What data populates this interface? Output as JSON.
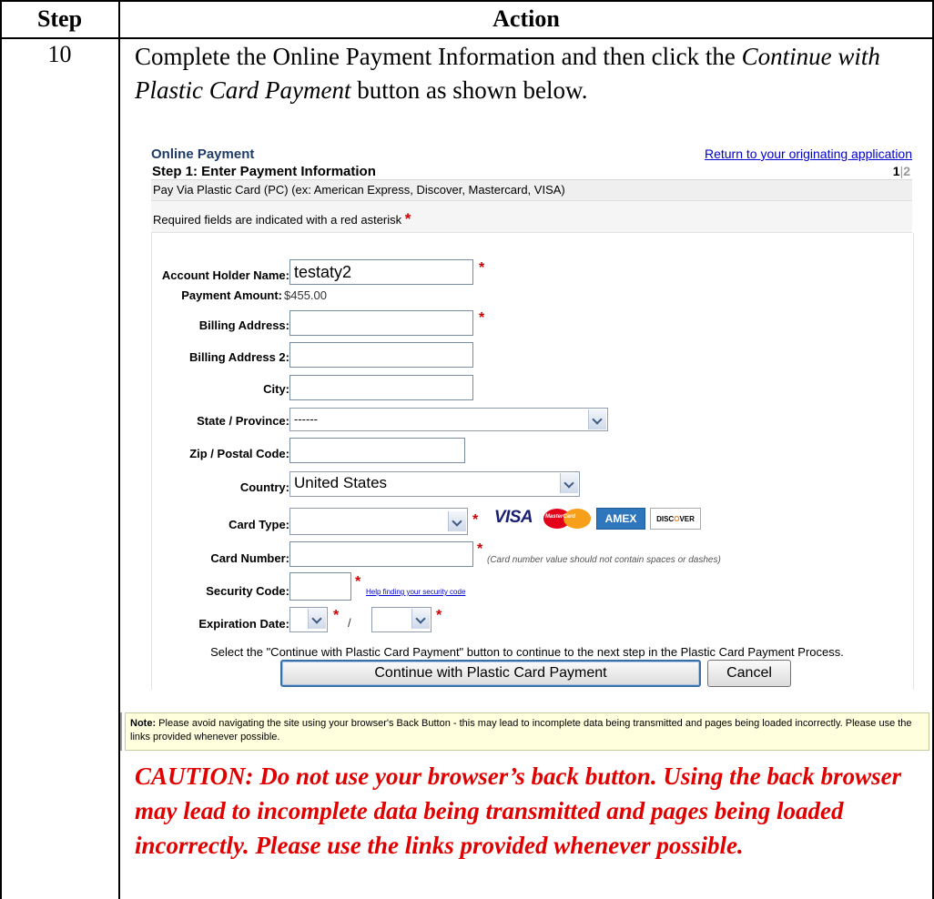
{
  "table": {
    "header_step": "Step",
    "header_action": "Action",
    "step_number": "10",
    "instruction_part1": "Complete the Online Payment Information and then click the ",
    "instruction_italic": "Continue with Plastic Card Payment",
    "instruction_part2": " button as shown below.",
    "caution": "CAUTION:  Do not use your browser’s back button.  Using the back browser may lead to incomplete data being transmitted and pages being loaded incorrectly.  Please use the links provided whenever possible."
  },
  "screen": {
    "title": "Online Payment",
    "return_link": "Return to your originating application",
    "step_title": "Step 1: Enter Payment Information",
    "page_current": "1",
    "page_sep": "|",
    "page_next": "2",
    "pay_via": "Pay Via Plastic Card (PC) (ex: American Express, Discover, Mastercard, VISA)",
    "required_note": "Required fields are indicated with a red asterisk",
    "required_star": "*",
    "form": {
      "account_holder_label": "Account Holder Name:",
      "account_holder_value": "testaty2",
      "payment_amount_label": "Payment Amount:",
      "payment_amount_value": "$455.00",
      "billing_address_label": "Billing Address:",
      "billing_address2_label": "Billing Address 2:",
      "city_label": "City:",
      "state_label": "State / Province:",
      "state_value": "------",
      "zip_label": "Zip / Postal Code:",
      "country_label": "Country:",
      "country_value": "United States",
      "card_type_label": "Card Type:",
      "card_number_label": "Card Number:",
      "card_number_hint": "(Card number value should not contain spaces or dashes)",
      "security_code_label": "Security Code:",
      "security_help": "Help finding your security code",
      "expiration_label": "Expiration Date:",
      "expiration_sep": "/",
      "star": "*"
    },
    "card_logos": {
      "visa": "VISA",
      "mastercard": "MasterCard",
      "amex": "AMEX",
      "discover_pre": "DISC",
      "discover_o": "O",
      "discover_post": "VER"
    },
    "select_message": "Select the \"Continue with Plastic Card Payment\" button to continue to the next step in the Plastic Card Payment Process.",
    "continue_button": "Continue with Plastic Card Payment",
    "cancel_button": "Cancel",
    "note_label": "Note:",
    "note_text": " Please avoid navigating the site using your browser's Back Button - this may lead to incomplete data being transmitted and pages being loaded incorrectly. Please use the links provided whenever possible."
  }
}
